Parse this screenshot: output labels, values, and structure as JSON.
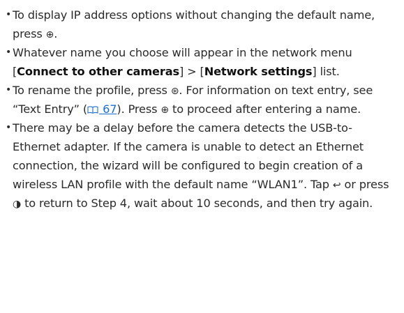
{
  "notes": {
    "n1": {
      "text_a": "To display IP address options without changing the default name, press ",
      "zoom_in_glyph": "⊕",
      "text_b": "."
    },
    "n2": {
      "text_a": "Whatever name you choose will appear in the network menu [",
      "menu_connect": "Connect to other cameras",
      "text_b": "] > [",
      "menu_network": "Network settings",
      "text_c": "] list."
    },
    "n3": {
      "text_a": "To rename the profile, press ",
      "ok_glyph": "⊛",
      "text_b": ". For information on text entry, see “Text Entry” (",
      "page_ref": "67",
      "text_c": "). Press ",
      "zoom_glyph": "⊕",
      "text_d": " to proceed after entering a name."
    },
    "n4": {
      "text_a": "There may be a delay before the camera detects the USB-to-Ethernet adapter. If the camera is unable to detect an Ethernet connection, the wizard will be configured to begin creation of a wireless LAN profile with the default name “WLAN1”. Tap ",
      "return_glyph": "↩",
      "text_b": " or press ",
      "multi_glyph": "◑",
      "text_c": " to return to Step 4, wait about 10 seconds, and then try again."
    }
  },
  "colors": {
    "text": "#2b2b2b",
    "link": "#1a6fd0"
  },
  "icons": {
    "zoom_in": "zoom-in-button-icon",
    "ok": "ok-button-icon",
    "return": "return-icon",
    "multi_selector": "multi-selector-icon",
    "page_reference": "book-icon"
  }
}
